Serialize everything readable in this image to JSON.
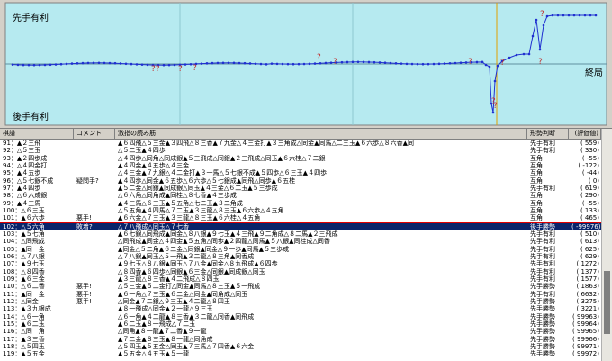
{
  "graph": {
    "label_top": "先手有利",
    "label_bottom": "後手有利",
    "label_end": "終局",
    "marks": [
      "??",
      "?",
      "?",
      "?",
      "?",
      "?",
      "?",
      "?",
      "?",
      "?",
      "?"
    ],
    "colors": {
      "bg": "#b6eaf0",
      "line": "#2030d0",
      "mark": "#c03030",
      "cursor": "#e0a000"
    }
  },
  "list": {
    "headers": [
      "棋譜",
      "コメント",
      "激指の読み筋",
      "形勢判断",
      "(評価値)"
    ],
    "rows": [
      [
        "91：▲２三飛",
        "",
        "▲６四飛△５三金▲３四飛△８三香▲７九金△４三金打▲３三角成△同金▲同馬△二三玉▲６六歩△８六香▲同",
        "先手有利",
        "559"
      ],
      [
        "92：△５三玉",
        "",
        "△５二玉▲４四歩",
        "先手有利",
        "330"
      ],
      [
        "93：▲２四歩成",
        "",
        "△４四歩△同角△同成銀▲５三飛成△同銀▲２三飛成△同玉▲６六桂△７二銀",
        "互角",
        "-55"
      ],
      [
        "94：△４四金打",
        "",
        "▲４四金▲４五歩△４三金",
        "互角",
        "-122"
      ],
      [
        "95：▲４五歩",
        "",
        "△４三金▲７九銀△４二金打▲３一馬△５七銀不成▲５四歩△６三玉▲４四歩",
        "互角",
        "-44"
      ],
      [
        "96：△５七銀不成",
        "疑問手?",
        "▲４四歩△同金▲６五歩△６六歩△５七銀成▲同飛△同歩▲６五桂",
        "互角",
        "0"
      ],
      [
        "97：▲４四歩",
        "",
        "▲５二金△同銀▲同成銀△同玉▲４三金△６二玉▲５三歩成",
        "先手有利",
        "619"
      ],
      [
        "98：△６六成銀",
        "",
        "△６六角△同角成▲同桂△８七香▲４三歩成",
        "互角",
        "290"
      ],
      [
        "99：▲４三馬",
        "",
        "▲４三馬△６三玉▲５五角△七二玉▲３二角成",
        "互角",
        "-55"
      ],
      [
        "100：△６三玉",
        "",
        "△５五角▲４四馬△７二玉▲３三龍△８三玉▲６六歩△４五角",
        "互角",
        "133"
      ],
      [
        "101：▲６六歩",
        "悪手!",
        "▲６六金△７三玉▲３三龍△８三玉▲６六桂△４五角",
        "互角",
        "465"
      ],
      [
        "102：△５六角",
        "敗着?",
        "△７八飛成△同玉△７七香",
        "後手勝勢",
        "-99976"
      ],
      [
        "103：▲５七角",
        "",
        "▲６七銀△同飛成▲同金△８八銀▲９七玉▲４三飛▲９二角成△８二馬▲２三飛成",
        "先手有利",
        "510"
      ],
      [
        "104：△同飛成",
        "",
        "△同飛成▲同金△４四金▲５五角△同歩▲２四龍△同馬▲５八銀▲同桂成△同香",
        "先手有利",
        "613"
      ],
      [
        "105：▲同　金",
        "",
        "▲同金△５二角▲６二金△同銀▲同金△９一歩▲同馬▲５三歩成",
        "先手有利",
        "625"
      ],
      [
        "106：△７八銀",
        "",
        "△７八銀▲同玉△５一飛▲３二龍△８三角▲同香成",
        "先手有利",
        "629"
      ],
      [
        "107：▲９七玉",
        "",
        "▲９七玉△８八銀▲同玉△７八金▲同金△８九飛成▲６四歩",
        "先手有利",
        "1272"
      ],
      [
        "108：△８四香",
        "",
        "△８四香▲６四歩△同銀▲６三金△同銀▲同成銀△同玉",
        "先手有利",
        "1377"
      ],
      [
        "109：▲６三金",
        "",
        "▲３三龍△８三香▲４二飛成△８四玉",
        "先手有利",
        "1577"
      ],
      [
        "110：△６二香",
        "悪手!",
        "△５三金▲５二金打△同金▲同馬△８三玉▲５一飛成",
        "先手勝勢",
        "1863"
      ],
      [
        "111：▲同　金",
        "悪手!",
        "▲６一角△７三玉▲６二金△同金▲同角成△同玉",
        "先手有利",
        "6632"
      ],
      [
        "112：△同金",
        "悪手!",
        "△同金▲７二銀△９三玉▲４二龍△８四玉",
        "先手勝勢",
        "3275"
      ],
      [
        "113：▲３九銀成",
        "",
        "▲８一飛成△同金▲２一龍△９三玉",
        "先手勝勢",
        "3221"
      ],
      [
        "114：△６一角",
        "",
        "△６一角▲４二龍▲８三香▲３二龍△同香▲同飛成",
        "先手勝勢",
        "99963"
      ],
      [
        "115：▲６二玉",
        "",
        "▲６二玉▲８一飛成△７二玉",
        "先手勝勢",
        "99964"
      ],
      [
        "116：△同　角",
        "",
        "△同角▲８一龍▲７二香▲９一龍",
        "先手勝勢",
        "99965"
      ],
      [
        "117：▲３三香",
        "",
        "▲７二金▲８三玉▲８一龍△同角成",
        "先手勝勢",
        "99966"
      ],
      [
        "118：△５四玉",
        "",
        "△５四玉▲５五金△同玉▲７三馬△７四香▲６六金",
        "先手勝勢",
        "99971"
      ],
      [
        "119：▲５五金",
        "",
        "▲５五金△４五玉▲５一龍",
        "先手勝勢",
        "99972"
      ]
    ]
  }
}
